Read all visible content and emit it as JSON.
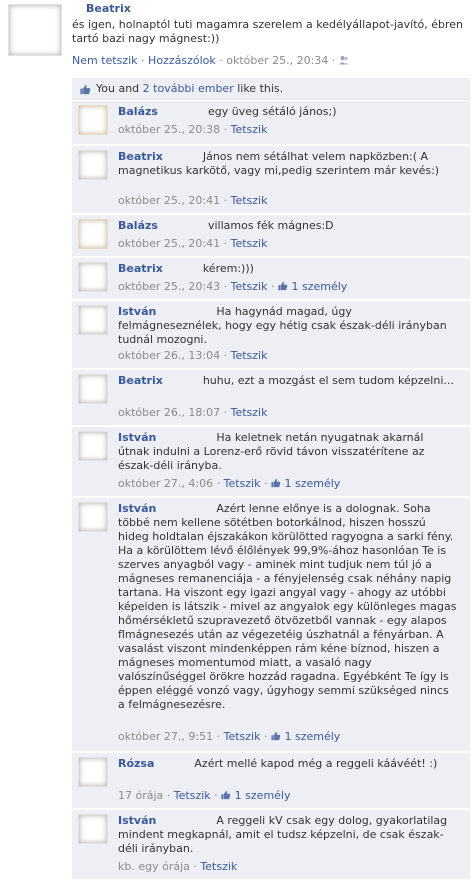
{
  "post": {
    "author": "Beatrix",
    "text": "és igen, holnaptól tuti magamra szerelem a kedélyállapot-javító, ébren tartó bazi nagy mágnest:))",
    "unlike": "Nem tetszik",
    "comment": "Hozzászólok",
    "time": "október 25., 20:34"
  },
  "likes": {
    "you": "You and",
    "others_link": "2 további ember",
    "suffix": "like this."
  },
  "comments": [
    {
      "author": "Balázs",
      "text": "egy üveg sétáló jános;)",
      "time": "október 25., 20:38",
      "like": "Tetszik"
    },
    {
      "author": "Beatrix",
      "text": "János nem sétálhat velem napközben:( A magnetikus karkötő, vagy mi,pedig szerintem már kevés:)",
      "time": "október 25., 20:41",
      "like": "Tetszik"
    },
    {
      "author": "Balázs",
      "text": "villamos fék mágnes:D",
      "time": "október 25., 20:41",
      "like": "Tetszik"
    },
    {
      "author": "Beatrix",
      "text": "kérem:)))",
      "time": "október 25., 20:43",
      "like": "Tetszik",
      "likes": "1 személy"
    },
    {
      "author": "István",
      "text": "Ha hagynád magad, úgy felmágneseznélek, hogy egy hétig csak észak-déli irányban tudnál mozogni.",
      "time": "október 26., 13:04",
      "like": "Tetszik"
    },
    {
      "author": "Beatrix",
      "text": "huhu, ezt a mozgást el sem tudom képzelni...",
      "time": "október 26., 18:07",
      "like": "Tetszik"
    },
    {
      "author": "István",
      "text": "Ha keletnek netán nyugatnak akarnál útnak indulni a Lorenz-erő rövid távon visszatérítene az észak-déli irányba.",
      "time": "október 27., 4:06",
      "like": "Tetszik",
      "likes": "1 személy"
    },
    {
      "author": "István",
      "text": "Azért lenne előnye is a dolognak. Soha többé nem kellene sötétben botorkálnod, hiszen hosszú hideg holdtalan éjszakákon körülötted ragyogna a sarki fény. Ha a körülöttem lévő élőlények 99,9%-ához hasonlóan Te is szerves anyagból vagy - aminek mint tudjuk nem túl jó a mágneses remanenciája - a fényjelenség csak néhány napig tartana. Ha viszont egy igazi angyal vagy - ahogy az utóbbi képeiden is látszik - mivel az angyalok egy különleges magas hőmérsékletű szupravezető ötvözetből vannak - egy alapos flmágnesezés után az végezetéig úszhatnál a fényárban. A vasalást viszont mindenképpen rám kéne bíznod, hiszen a mágneses momentumod miatt, a vasaló nagy valószínűséggel örökre hozzád ragadna. Egyébként Te így is éppen eléggé vonzó vagy, úgyhogy semmi szükséged nincs a felmágnesezésre.",
      "time": "október 27., 9:51",
      "like": "Tetszik",
      "likes": "1 személy"
    },
    {
      "author": "Rózsa",
      "text": "Azért mellé kapod még a reggeli káávéét! :)",
      "time": "17 órája",
      "like": "Tetszik",
      "likes": "1 személy"
    },
    {
      "author": "István",
      "text": "A reggeli kV csak egy dolog, gyakorlatilag mindent megkapnál, amit el tudsz képzelni, de csak észak-déli irányban.",
      "time": "kb. egy órája",
      "like": "Tetszik"
    }
  ],
  "icons": {
    "people": "people-icon",
    "like": "thumbs-up-icon"
  },
  "colors": {
    "name": "#3b5998",
    "meta": "#8a8a8a",
    "comment_bg": "#edeff4"
  }
}
